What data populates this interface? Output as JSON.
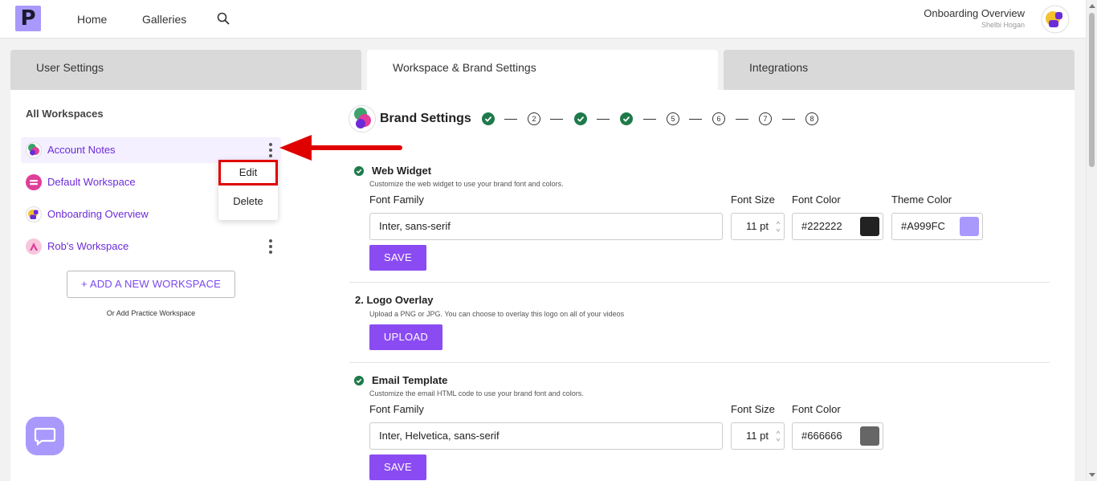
{
  "nav": {
    "logo": "P",
    "home": "Home",
    "galleries": "Galleries"
  },
  "account": {
    "title": "Onboarding Overview",
    "user": "Shelbi Hogan"
  },
  "tabs": [
    "User Settings",
    "Workspace & Brand Settings",
    "Integrations"
  ],
  "sidebar": {
    "heading": "All Workspaces",
    "workspaces": [
      {
        "label": "Account Notes"
      },
      {
        "label": "Default Workspace"
      },
      {
        "label": "Onboarding Overview"
      },
      {
        "label": "Rob's Workspace"
      }
    ],
    "menu": {
      "edit": "Edit",
      "delete": "Delete"
    },
    "add_button": "+ ADD A NEW WORKSPACE",
    "practice": "Or Add Practice Workspace"
  },
  "brand": {
    "title": "Brand Settings",
    "steps": [
      "✔",
      "2",
      "✔",
      "✔",
      "5",
      "6",
      "7",
      "8"
    ]
  },
  "web_widget": {
    "title": "Web Widget",
    "desc": "Customize the web widget to use your brand font and colors.",
    "font_family_label": "Font Family",
    "font_family": "Inter, sans-serif",
    "font_size_label": "Font Size",
    "font_size": "11 pt",
    "font_color_label": "Font Color",
    "font_color": "#222222",
    "theme_color_label": "Theme Color",
    "theme_color": "#A999FC",
    "save": "SAVE"
  },
  "logo_overlay": {
    "title": "2.  Logo Overlay",
    "desc": "Upload a PNG or JPG. You can choose to overlay this logo on all of your videos",
    "upload": "UPLOAD"
  },
  "email_template": {
    "title": "Email Template",
    "desc": "Customize the email HTML code to use your brand font and colors.",
    "font_family_label": "Font Family",
    "font_family": "Inter, Helvetica, sans-serif",
    "font_size_label": "Font Size",
    "font_size": "11 pt",
    "font_color_label": "Font Color",
    "font_color": "#666666",
    "save": "SAVE"
  },
  "colors": {
    "accent": "#8a4bf2",
    "theme": "#A999FC",
    "done": "#1e7a4a",
    "highlight": "#e00000"
  },
  "icons": [
    "search-icon",
    "chevron-icon",
    "check-icon",
    "kebab-icon",
    "arrow-icon",
    "chat-icon"
  ]
}
